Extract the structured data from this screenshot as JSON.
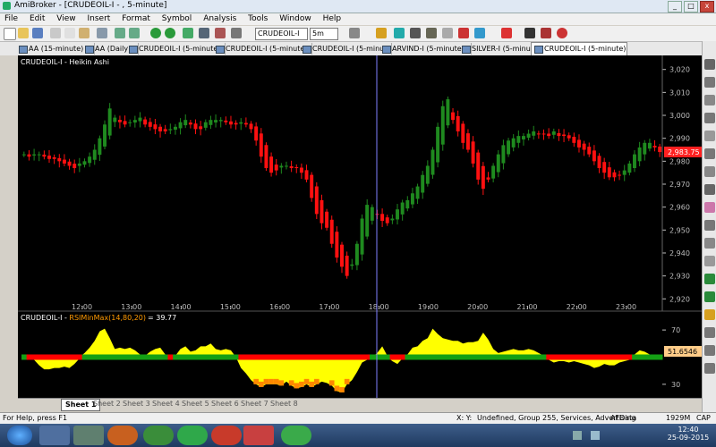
{
  "window": {
    "title": "AmiBroker - [CRUDEOIL-I - , 5-minute]",
    "min": "_",
    "max": "□",
    "close": "x"
  },
  "menu": [
    "File",
    "Edit",
    "View",
    "Insert",
    "Format",
    "Symbol",
    "Analysis",
    "Tools",
    "Window",
    "Help"
  ],
  "toolbar": {
    "symbol": "CRUDEOIL-I",
    "interval": "5m"
  },
  "tabs": [
    {
      "label": "AA (15-minute)"
    },
    {
      "label": "AA (Daily)"
    },
    {
      "label": "CRUDEOIL-I (5-minute)"
    },
    {
      "label": "CRUDEOIL-I (5-minute)"
    },
    {
      "label": "CRUDEOIL-I (5-minute)"
    },
    {
      "label": "ARVIND-I (5-minute)"
    },
    {
      "label": "SILVER-I (5-minute)"
    },
    {
      "label": "CRUDEOIL-I (5-minute)"
    }
  ],
  "colors": {
    "up": "#1f8a1f",
    "down": "#ff1010",
    "cursor": "#8080ff",
    "rsiHigh": "#ffff00",
    "rsiLow": "#ffff00",
    "band": "#ff0000",
    "mid": "#14a014",
    "axis": "#bdbdbd"
  },
  "chart_data": [
    {
      "type": "candlestick",
      "title": "CRUDEOIL-I - Heikin Ashi",
      "yticks": [
        "3,020",
        "3,010",
        "3,000",
        "2,990",
        "2,980",
        "2,970",
        "2,960",
        "2,950",
        "2,940",
        "2,930",
        "2,920"
      ],
      "ylim": [
        2917,
        3023
      ],
      "xticks": [
        "12:00",
        "13:00",
        "14:00",
        "15:00",
        "16:00",
        "17:00",
        "18:00",
        "19:00",
        "20:00",
        "21:00",
        "22:00",
        "23:00"
      ],
      "last_price": "2,983.75",
      "closes": [
        2983,
        2982,
        2983,
        2983,
        2982,
        2981,
        2981,
        2980,
        2979,
        2978,
        2977,
        2979,
        2980,
        2982,
        2985,
        2990,
        2996,
        3003,
        2999,
        2997,
        2996,
        2997,
        2998,
        2999,
        2996,
        2995,
        2994,
        2993,
        2993,
        2994,
        2995,
        2997,
        2998,
        2996,
        2994,
        2994,
        2997,
        2998,
        2998,
        2998,
        2997,
        2996,
        2996,
        2997,
        2996,
        2994,
        2989,
        2982,
        2977,
        2975,
        2976,
        2978,
        2978,
        2977,
        2977,
        2975,
        2972,
        2964,
        2957,
        2953,
        2951,
        2944,
        2938,
        2934,
        2930,
        2935,
        2944,
        2955,
        2961,
        2960,
        2957,
        2954,
        2953,
        2955,
        2959,
        2962,
        2963,
        2966,
        2969,
        2974,
        2978,
        2985,
        2995,
        3004,
        3007,
        2998,
        2993,
        2988,
        2985,
        2979,
        2972,
        2968,
        2972,
        2978,
        2983,
        2987,
        2989,
        2990,
        2991,
        2991,
        2992,
        2993,
        2992,
        2992,
        2991,
        2993,
        2991,
        2991,
        2990,
        2988,
        2986,
        2985,
        2983,
        2980,
        2977,
        2975,
        2973,
        2973,
        2974,
        2976,
        2979,
        2983,
        2986,
        2988,
        2988,
        2986,
        2984
      ]
    },
    {
      "type": "area",
      "title": "CRUDEOIL-I - ",
      "indicator": "RSIMinMax(14,80,20)",
      "value": "= 39.77",
      "last_value": "51.6546",
      "yticks": [
        "70",
        "30"
      ],
      "ylim": [
        22,
        76
      ],
      "midline": 50,
      "values": [
        50,
        49,
        48,
        44,
        41,
        41,
        42,
        42,
        43,
        42,
        45,
        49,
        53,
        57,
        62,
        69,
        71,
        64,
        56,
        57,
        56,
        57,
        55,
        52,
        51,
        54,
        56,
        57,
        52,
        48,
        51,
        56,
        58,
        54,
        55,
        58,
        58,
        60,
        56,
        55,
        56,
        55,
        50,
        42,
        38,
        33,
        30,
        28,
        30,
        30,
        30,
        29,
        32,
        29,
        27,
        28,
        30,
        28,
        30,
        32,
        31,
        29,
        25,
        24,
        30,
        33,
        39,
        46,
        48,
        50,
        53,
        58,
        51,
        47,
        45,
        49,
        52,
        57,
        58,
        62,
        64,
        71,
        67,
        64,
        63,
        62,
        62,
        60,
        61,
        61,
        62,
        68,
        63,
        56,
        53,
        54,
        55,
        56,
        55,
        55,
        56,
        55,
        53,
        51,
        48,
        46,
        47,
        47,
        46,
        47,
        46,
        45,
        44,
        42,
        43,
        45,
        44,
        44,
        46,
        47,
        48,
        52,
        55,
        54,
        52,
        51,
        51
      ]
    }
  ],
  "sheets": [
    "Sheet 1",
    "Sheet 2",
    "Sheet 3",
    "Sheet 4",
    "Sheet 5",
    "Sheet 6",
    "Sheet 7",
    "Sheet 8"
  ],
  "status": {
    "help": "For Help, press F1",
    "xy": "X:  Y:",
    "group": "Undefined, Group 255, Services, Advertising",
    "source": "AFData",
    "mem": "1929M",
    "cap": "CAP"
  },
  "taskbar": {
    "time": "12:40",
    "date": "25-09-2015"
  }
}
